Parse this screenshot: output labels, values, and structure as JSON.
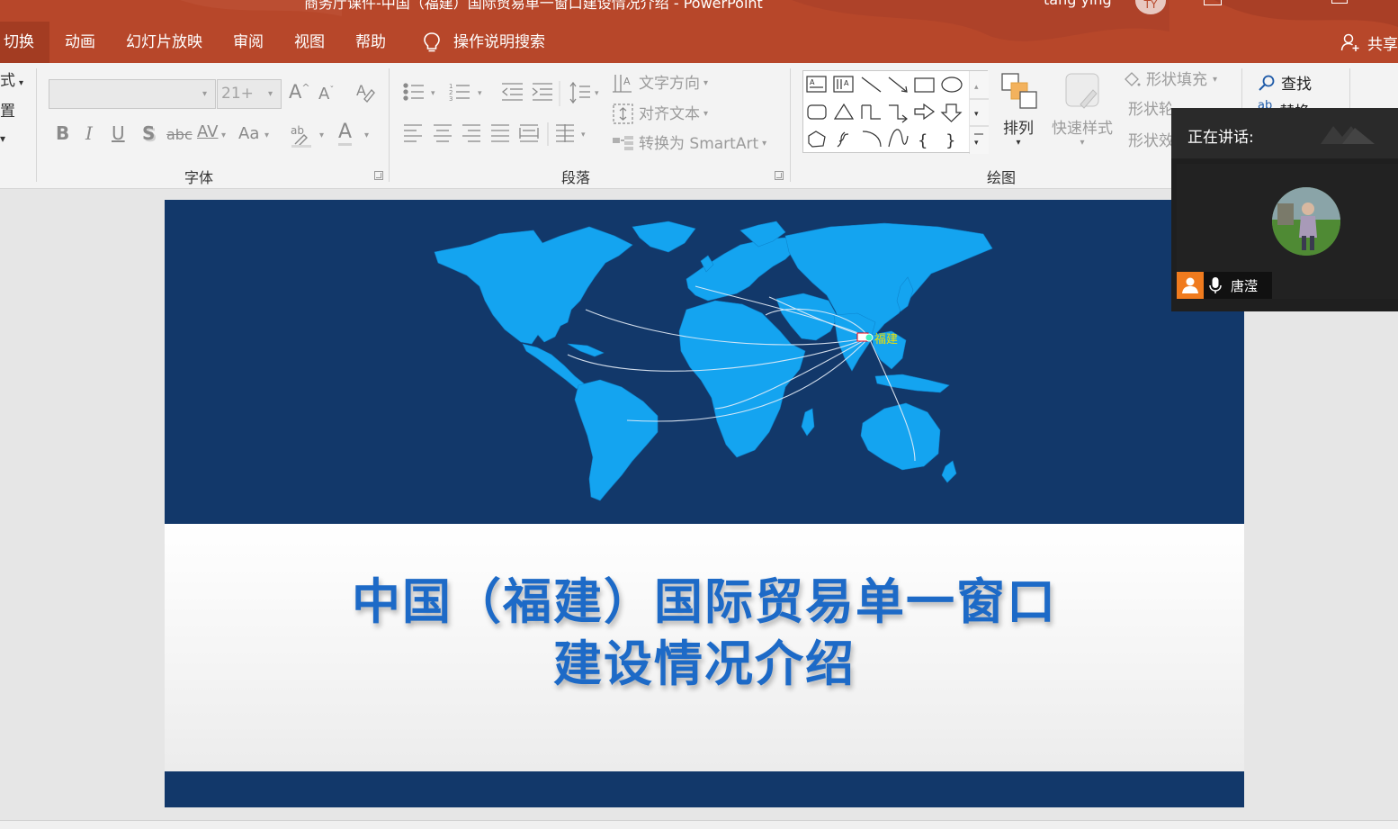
{
  "window": {
    "document_title": "商务厅课件-中国（福建）国际贸易单一窗口建设情况介绍 - PowerPoint",
    "user_name": "tang ying",
    "user_initials": "TY"
  },
  "tabs": [
    {
      "label": "切换",
      "active": true
    },
    {
      "label": "动画",
      "active": false
    },
    {
      "label": "幻灯片放映",
      "active": false
    },
    {
      "label": "审阅",
      "active": false
    },
    {
      "label": "视图",
      "active": false
    },
    {
      "label": "帮助",
      "active": false
    }
  ],
  "tell_me": {
    "label": "操作说明搜索"
  },
  "share": {
    "label": "共享"
  },
  "ribbon": {
    "left_clip": {
      "item1": "式",
      "item2": "置"
    },
    "font_group": {
      "label": "字体",
      "font_name": "",
      "font_size": "21+",
      "bold": "B",
      "italic": "I",
      "underline": "U",
      "shadow": "S",
      "strike": "abc",
      "spacing": "AV",
      "case": "Aa",
      "color": "A"
    },
    "paragraph_group": {
      "label": "段落",
      "text_direction": "文字方向",
      "align_text": "对齐文本",
      "smartart": "转换为 SmartArt"
    },
    "drawing_group": {
      "label": "绘图",
      "arrange": "排列",
      "quick_styles": "快速样式",
      "shape_fill": "形状填充",
      "shape_outline": "形状轮廓",
      "shape_effects": "形状效果"
    },
    "editing_group": {
      "find": "查找",
      "replace": "替换"
    }
  },
  "slide": {
    "title_line1": "中国（福建）国际贸易单一窗口",
    "title_line2": "建设情况介绍",
    "map_label": "福建"
  },
  "meeting": {
    "speaking_label": "正在讲话:",
    "speaker_name": "唐滢"
  },
  "colors": {
    "accent": "#b7472a",
    "slide_navy": "#12386a",
    "map_blue": "#14a4f0",
    "title_blue": "#1d6ac7"
  }
}
